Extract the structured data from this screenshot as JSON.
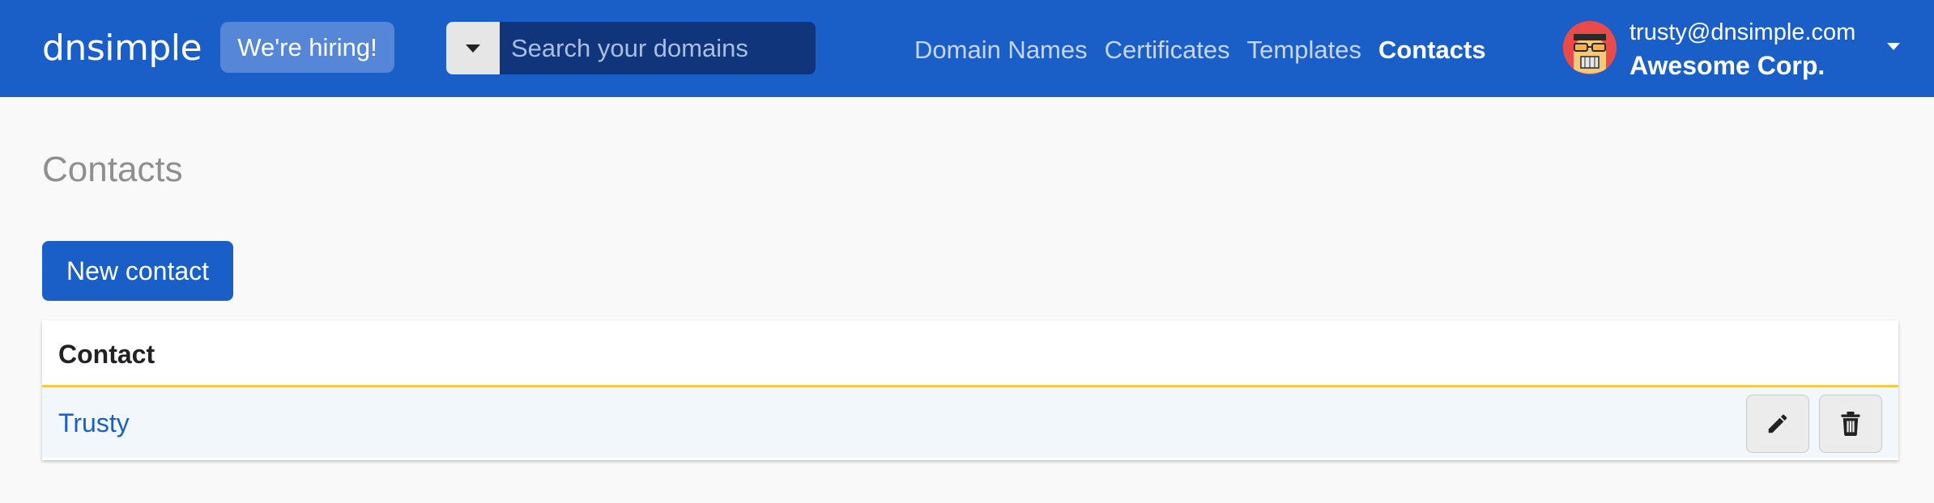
{
  "header": {
    "logo_text": "dnsimple",
    "hiring_badge": "We're hiring!",
    "search": {
      "placeholder": "Search your domains",
      "value": ""
    },
    "nav": [
      {
        "label": "Domain Names",
        "active": false
      },
      {
        "label": "Certificates",
        "active": false
      },
      {
        "label": "Templates",
        "active": false
      },
      {
        "label": "Contacts",
        "active": true
      }
    ],
    "account": {
      "email": "trusty@dnsimple.com",
      "org": "Awesome Corp."
    }
  },
  "main": {
    "title": "Contacts",
    "new_contact_label": "New contact",
    "table": {
      "column_header": "Contact",
      "rows": [
        {
          "name": "Trusty"
        }
      ]
    }
  },
  "colors": {
    "brand_blue": "#1a5ec8",
    "header_underline": "#f5c84a",
    "row_background": "#f1f7fb",
    "page_background": "#f9f9f9"
  },
  "icons": {
    "search_toggle": "chevron-down-icon",
    "edit": "pencil-icon",
    "delete": "trash-icon",
    "account_menu": "chevron-down-icon"
  }
}
